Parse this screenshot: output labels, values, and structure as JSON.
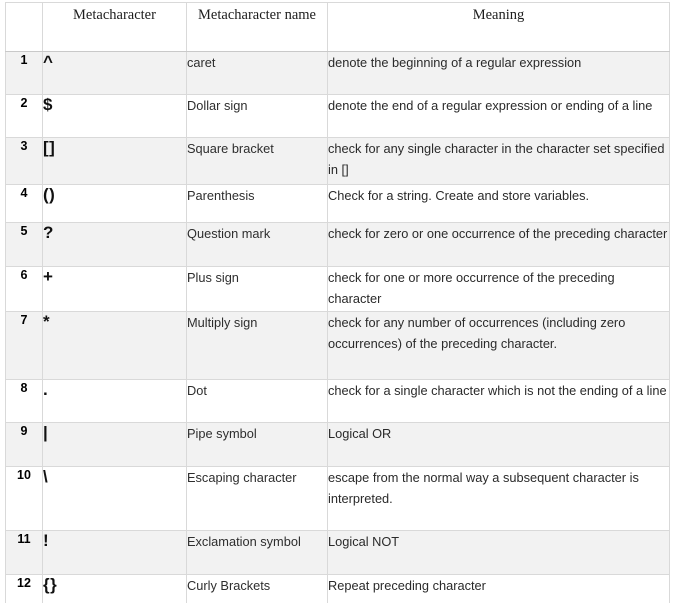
{
  "table": {
    "headers": {
      "number": "",
      "metacharacter": "Metacharacter",
      "metacharacter_name": "Metacharacter name",
      "meaning": "Meaning"
    },
    "rows": [
      {
        "num": "1",
        "char": "^",
        "name": "caret",
        "meaning": "denote the beginning of a regular expression"
      },
      {
        "num": "2",
        "char": "$",
        "name": "Dollar sign",
        "meaning": "denote the end of a regular expression or ending of a line"
      },
      {
        "num": "3",
        "char": "[]",
        "name": "Square bracket",
        "meaning": "check for any single character in the character set specified in []"
      },
      {
        "num": "4",
        "char": "()",
        "name": "Parenthesis",
        "meaning": "Check for a string. Create and store variables."
      },
      {
        "num": "5",
        "char": "?",
        "name": "Question mark",
        "meaning": "check for zero or one occurrence of the preceding character"
      },
      {
        "num": "6",
        "char": "+",
        "name": "Plus sign",
        "meaning": "check for one or more occurrence of the preceding character"
      },
      {
        "num": "7",
        "char": "*",
        "name": "Multiply sign",
        "meaning": "check for any number of occurrences (including zero occurrences) of the preceding character."
      },
      {
        "num": "8",
        "char": ".",
        "name": "Dot",
        "meaning": "check for a single character which is not the ending of a line"
      },
      {
        "num": "9",
        "char": "|",
        "name": "Pipe symbol",
        "meaning": "Logical OR"
      },
      {
        "num": "10",
        "char": "\\",
        "name": "Escaping character",
        "meaning": "escape from the normal way a subsequent character is interpreted."
      },
      {
        "num": "11",
        "char": "!",
        "name": "Exclamation symbol",
        "meaning": "Logical NOT"
      },
      {
        "num": "12",
        "char": "{}",
        "name": "Curly Brackets",
        "meaning": "Repeat preceding character"
      }
    ]
  },
  "colors": {
    "shaded_row": "#f2f2f2",
    "plain_row": "#ffffff",
    "border": "#d9d9d9",
    "text": "#2a2a2a"
  }
}
